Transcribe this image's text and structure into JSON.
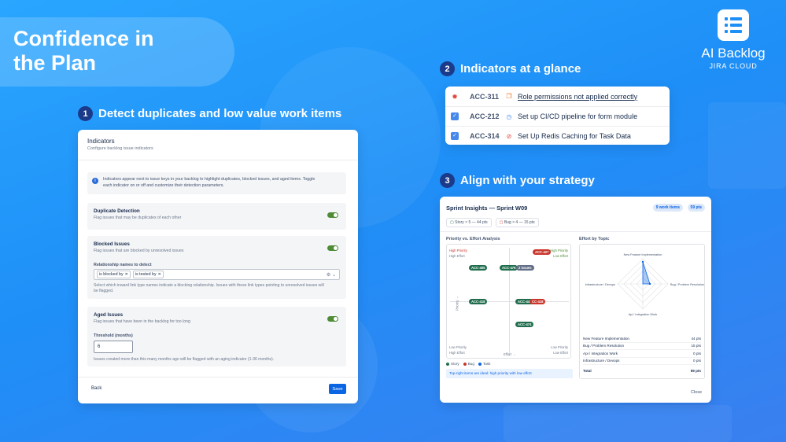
{
  "hero": {
    "title_line1": "Confidence in",
    "title_line2": "the Plan"
  },
  "brand": {
    "name": "AI Backlog",
    "sub": "JIRA CLOUD"
  },
  "steps": [
    {
      "num": "1",
      "label": "Detect duplicates and low value work items"
    },
    {
      "num": "2",
      "label": "Indicators at a glance"
    },
    {
      "num": "3",
      "label": "Align with your strategy"
    }
  ],
  "indicators_panel": {
    "title": "Indicators",
    "subtitle": "Configure backlog issue indicators",
    "info_line1": "Indicators appear next to issue keys in your backlog to highlight duplicates, blocked issues, and aged items. Toggle",
    "info_line2": "each indicator on or off and customize their detection parameters.",
    "duplicate": {
      "title": "Duplicate Detection",
      "desc": "Flag issues that may be duplicates of each other",
      "enabled": true
    },
    "blocked": {
      "title": "Blocked Issues",
      "desc": "Flag issues that are blocked by unresolved issues",
      "enabled": true,
      "field_label": "Relationship names to detect",
      "chips": [
        "is blocked by",
        "is tested by"
      ],
      "help_line1": "Select which inward link type names indicate a blocking relationship. Issues with these link types pointing to unresolved issues will",
      "help_line2": "be flagged."
    },
    "aged": {
      "title": "Aged Issues",
      "desc": "Flag issues that have been in the backlog for too long",
      "enabled": true,
      "field_label": "Threshold (months)",
      "value": "6",
      "help": "Issues created more than this many months ago will be flagged with an aging indicator (1-36 months)."
    },
    "back_label": "Back",
    "save_label": "Save"
  },
  "issue_rows": [
    {
      "key": "ACC-311",
      "title": "Role permissions not applied correctly",
      "type_icon": "bug-icon",
      "indicator": "duplicate-icon"
    },
    {
      "key": "ACC-212",
      "title": "Set up CI/CD pipeline for form module",
      "type_icon": "task-icon",
      "indicator": "clock-icon"
    },
    {
      "key": "ACC-314",
      "title": "Set Up Redis Caching for Task Data",
      "type_icon": "task-icon",
      "indicator": "blocked-icon"
    }
  ],
  "insights": {
    "title": "Sprint Insights — Sprint W09",
    "work_items": "9 work items",
    "pts": "59 pts",
    "badge_story": "Story × 5 — 44 pts",
    "badge_bug": "Bug × 4 — 15 pts",
    "matrix_title": "Priority vs. Effort Analysis",
    "topic_title": "Effort by Topic",
    "labels": {
      "tl1": "High Priority",
      "tl2": "High Effort",
      "tr1": "High Priority",
      "tr2": "Low Effort",
      "bl1": "Low Priority",
      "bl2": "High Effort",
      "br1": "Low Priority",
      "br2": "Low Effort",
      "y_axis": "Priority →",
      "x_axis": "Effort →"
    },
    "tags": [
      {
        "text": "ACC-405",
        "color": "#216e4e"
      },
      {
        "text": "ACC-476",
        "color": "#216e4e"
      },
      {
        "text": "2 issues",
        "color": "#626f86"
      },
      {
        "text": "ACC-427",
        "color": "#c9372c"
      },
      {
        "text": "ACC-418",
        "color": "#216e4e"
      },
      {
        "text": "ACC-443",
        "color": "#216e4e"
      },
      {
        "text": "CC-418",
        "color": "#c9372c"
      },
      {
        "text": "ACC-474",
        "color": "#216e4e"
      }
    ],
    "legend": {
      "story": "Story",
      "bug": "Bug",
      "task": "Task"
    },
    "tip": "Top-right items are ideal: high priority with low effort",
    "radar_labels": {
      "top": "New Feature Implementation",
      "right": "Bug / Problem Resolution",
      "bottom": "Api / Integration Work",
      "left": "Infrastructure / Devops"
    },
    "topics": [
      {
        "name": "New Feature Implementation",
        "pts": "44 pts"
      },
      {
        "name": "Bug / Problem Resolution",
        "pts": "15 pts"
      },
      {
        "name": "Api / Integration Work",
        "pts": "0 pts"
      },
      {
        "name": "Infrastructure / Devops",
        "pts": "0 pts"
      }
    ],
    "total_label": "Total",
    "total_pts": "59 pts",
    "close_label": "Close"
  },
  "colors": {
    "accent": "#0c66e4",
    "story": "#216e4e",
    "bug": "#c9372c",
    "task": "#0c66e4",
    "toggle_on": "#4e8d36"
  }
}
